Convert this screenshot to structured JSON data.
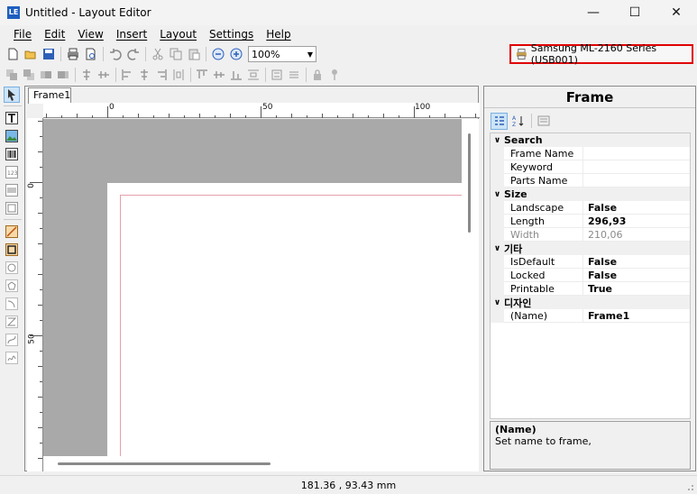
{
  "window": {
    "title": "Untitled - Layout Editor",
    "app_icon_text": "LE",
    "minimize": "—",
    "maximize": "☐",
    "close": "✕"
  },
  "menu": [
    "File",
    "Edit",
    "View",
    "Insert",
    "Layout",
    "Settings",
    "Help"
  ],
  "toolbar": {
    "zoom_value": "100%",
    "printer_label": "Samsung ML-2160 Series (USB001)"
  },
  "document": {
    "tab_label": "Frame1",
    "ruler_h_labels": [
      "0",
      "50",
      "100"
    ],
    "ruler_v_labels": [
      "0",
      "50"
    ]
  },
  "properties": {
    "title": "Frame",
    "categories": [
      {
        "name": "Search",
        "rows": [
          {
            "name": "Frame Name",
            "value": ""
          },
          {
            "name": "Keyword",
            "value": ""
          },
          {
            "name": "Parts Name",
            "value": ""
          }
        ]
      },
      {
        "name": "Size",
        "rows": [
          {
            "name": "Landscape",
            "value": "False"
          },
          {
            "name": "Length",
            "value": "296,93"
          },
          {
            "name": "Width",
            "value": "210,06"
          }
        ]
      },
      {
        "name": "기타",
        "rows": [
          {
            "name": "IsDefault",
            "value": "False"
          },
          {
            "name": "Locked",
            "value": "False"
          },
          {
            "name": "Printable",
            "value": "True"
          }
        ]
      },
      {
        "name": "디자인",
        "rows": [
          {
            "name": "(Name)",
            "value": "Frame1"
          }
        ]
      }
    ],
    "description_title": "(Name)",
    "description_text": "Set name to frame,"
  },
  "status": {
    "coordinates": "181.36 , 93.43 mm"
  },
  "colors": {
    "printer_highlight": "#e00000",
    "page_margin": "#e7a0ad",
    "canvas_bg": "#a9a9a9"
  }
}
